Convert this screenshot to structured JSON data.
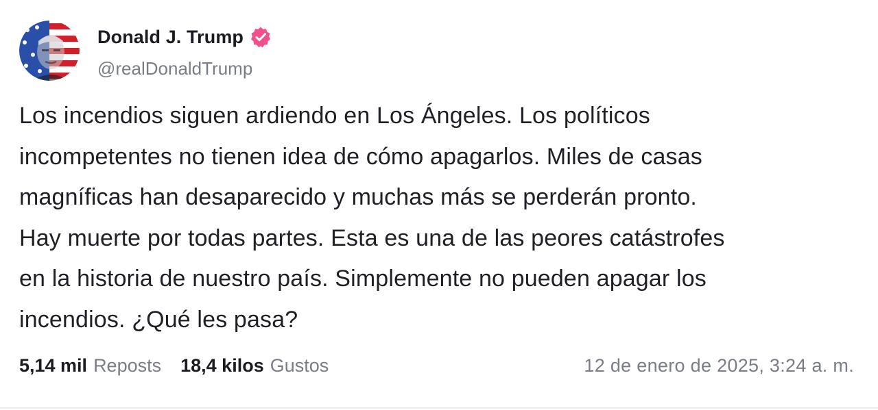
{
  "author": {
    "display_name": "Donald J. Trump",
    "handle": "@realDonaldTrump",
    "verified": true,
    "verified_color": "#f0508c",
    "avatar_icon": "flag-portrait-avatar"
  },
  "post": {
    "text": "Los incendios siguen ardiendo en Los Ángeles. Los políticos\nincompetentes no tienen idea de cómo apagarlos. Miles de casas\nmagníficas han desaparecido y muchas más se perderán pronto.\nHay muerte por todas partes. Esta es una de las peores catástrofes\nen la historia de nuestro país. Simplemente no pueden apagar los\nincendios. ¿Qué les pasa?"
  },
  "stats": {
    "reposts_value": "5,14 mil",
    "reposts_label": "Reposts",
    "likes_value": "18,4 kilos",
    "likes_label": "Gustos"
  },
  "timestamp": "12 de enero de 2025, 3:24 a. m.",
  "colors": {
    "text": "#1b1b21",
    "muted": "#7a7d85",
    "background": "#ffffff"
  }
}
